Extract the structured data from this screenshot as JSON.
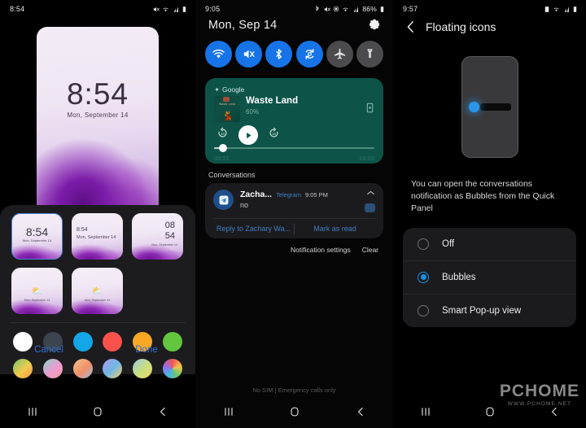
{
  "screen1": {
    "statusbar": {
      "time": "8:54",
      "battery": ""
    },
    "wallpaper_preview": {
      "time": "8:54",
      "date": "Mon, September 14"
    },
    "clock_styles": [
      {
        "name": "centered",
        "time": "8:54",
        "date": "Mon, September 14",
        "selected": true
      },
      {
        "name": "left-aligned",
        "time": "8:54",
        "date": "Mon, September 14",
        "selected": false
      },
      {
        "name": "stacked",
        "hour": "08",
        "minute": "54",
        "date": "Mon, September 14",
        "selected": false
      },
      {
        "name": "weather-left",
        "icon": "⛅",
        "date": "Mon, September 14",
        "selected": false
      },
      {
        "name": "weather-center",
        "icon": "⛅",
        "date": "Mon, September 14",
        "selected": false
      }
    ],
    "colors": {
      "row1": [
        "#ffffff",
        "#3b4550",
        "#13a7e8",
        "#f9524d",
        "#f9a826",
        "#62c63f"
      ],
      "row2": [
        "#eac64e",
        "#e6a0cf",
        "#f0a06a",
        "#8fa8e8",
        "#b6d46a",
        "#e34f9a"
      ]
    },
    "actions": {
      "cancel": "Cancel",
      "done": "Done"
    }
  },
  "screen2": {
    "statusbar": {
      "time": "9:05",
      "battery": "86%"
    },
    "date": "Mon, Sep 14",
    "settings_icon": "gear-icon",
    "toggles": [
      {
        "name": "wifi",
        "state": "on"
      },
      {
        "name": "sound-mute",
        "state": "on"
      },
      {
        "name": "bluetooth",
        "state": "on"
      },
      {
        "name": "auto-rotate",
        "state": "on"
      },
      {
        "name": "airplane-mode",
        "state": "off"
      },
      {
        "name": "flashlight",
        "state": "off"
      }
    ],
    "media": {
      "app": "Google",
      "title": "Waste Land",
      "artist": "60%",
      "album_art_text": "Waste Land",
      "elapsed": "00:21",
      "duration": "24:03",
      "progress_percent": 6
    },
    "conversations_label": "Conversations",
    "notification": {
      "sender": "Zacha...",
      "app": "Telegram",
      "time": "9:05 PM",
      "message": "no",
      "reply_action": "Reply to Zachary Wa...",
      "mark_read_action": "Mark as read"
    },
    "footer": {
      "settings": "Notification settings",
      "clear": "Clear"
    },
    "nosim": "No SIM | Emergency calls only"
  },
  "screen3": {
    "statusbar": {
      "time": "9:57",
      "battery": ""
    },
    "title": "Floating icons",
    "back_icon": "chevron-left-icon",
    "description": "You can open the conversations notification as Bubbles from the Quick Panel",
    "options": [
      {
        "label": "Off",
        "selected": false
      },
      {
        "label": "Bubbles",
        "selected": true
      },
      {
        "label": "Smart Pop-up view",
        "selected": false
      }
    ]
  },
  "watermark": {
    "main": "PCHOME",
    "sub": "WWW.PCHOME.NET"
  },
  "navbar": {
    "recents": "recents-icon",
    "home": "home-icon",
    "back": "back-icon"
  }
}
